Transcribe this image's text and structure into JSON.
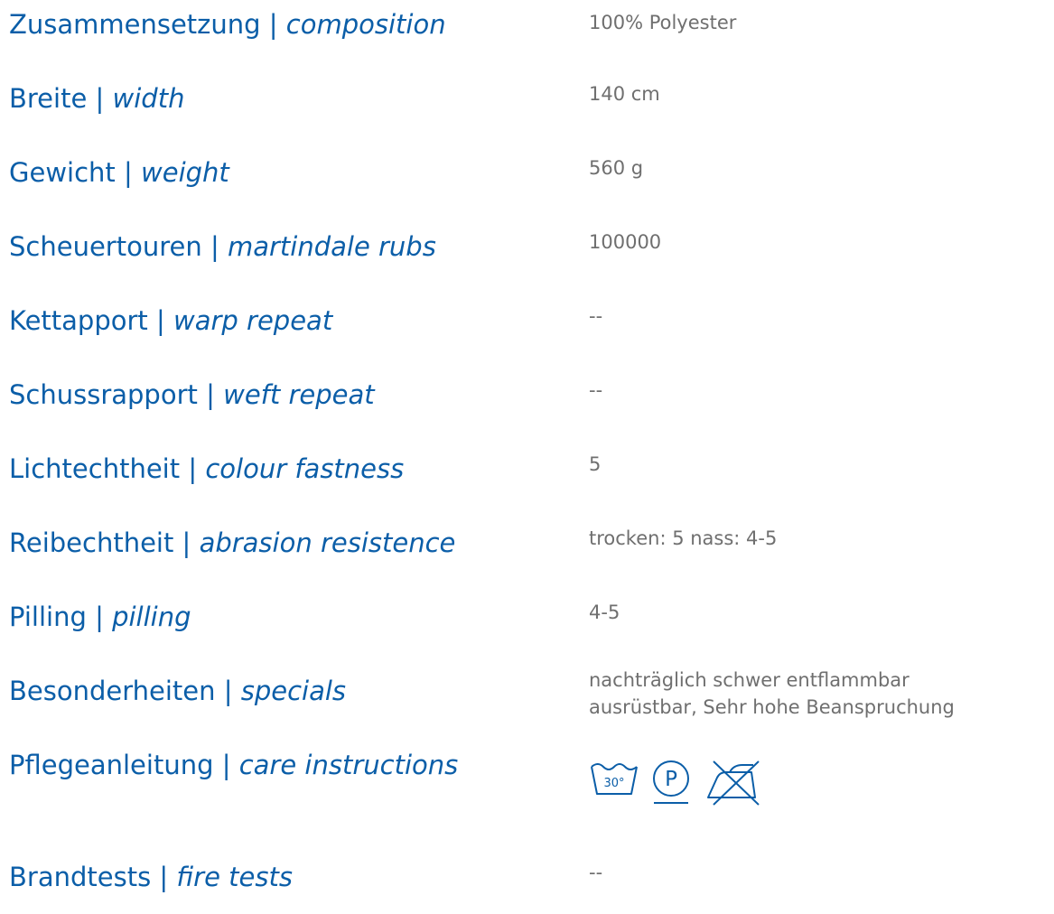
{
  "specs": [
    {
      "de": "Zusammensetzung",
      "sep": " | ",
      "en": "composition",
      "value": "100% Polyester"
    },
    {
      "de": "Breite",
      "sep": " | ",
      "en": "width",
      "value": "140 cm"
    },
    {
      "de": "Gewicht",
      "sep": " | ",
      "en": "weight",
      "value": "560 g"
    },
    {
      "de": "Scheuertouren",
      "sep": " | ",
      "en": "martindale rubs",
      "value": "100000"
    },
    {
      "de": "Kettapport",
      "sep": " | ",
      "en": "warp repeat",
      "value": "--"
    },
    {
      "de": "Schussrapport",
      "sep": " | ",
      "en": "weft repeat",
      "value": "--"
    },
    {
      "de": "Lichtechtheit",
      "sep": " | ",
      "en": "colour fastness",
      "value": "5"
    },
    {
      "de": "Reibechtheit",
      "sep": " | ",
      "en": "abrasion resistence",
      "value": "trocken: 5 nass: 4-5"
    },
    {
      "de": "Pilling",
      "sep": " | ",
      "en": "pilling",
      "value": "4-5"
    },
    {
      "de": "Besonderheiten",
      "sep": " | ",
      "en": "specials",
      "value_lines": [
        "nachträglich schwer entflammbar",
        "ausrüstbar, Sehr hohe Beanspruchung"
      ]
    },
    {
      "de": "Pflegeanleitung",
      "sep": " | ",
      "en": "care instructions",
      "care_icons": [
        {
          "icon": "wash-30-icon",
          "label": "30°"
        },
        {
          "icon": "dry-clean-p-icon",
          "label": "P"
        },
        {
          "icon": "do-not-iron-icon"
        }
      ]
    },
    {
      "de": "Brandtests",
      "sep": " | ",
      "en": "fire tests",
      "value": "--"
    }
  ],
  "colors": {
    "label": "#0b5ea8",
    "value": "#6f6f6f",
    "icon": "#0b5ea8"
  }
}
